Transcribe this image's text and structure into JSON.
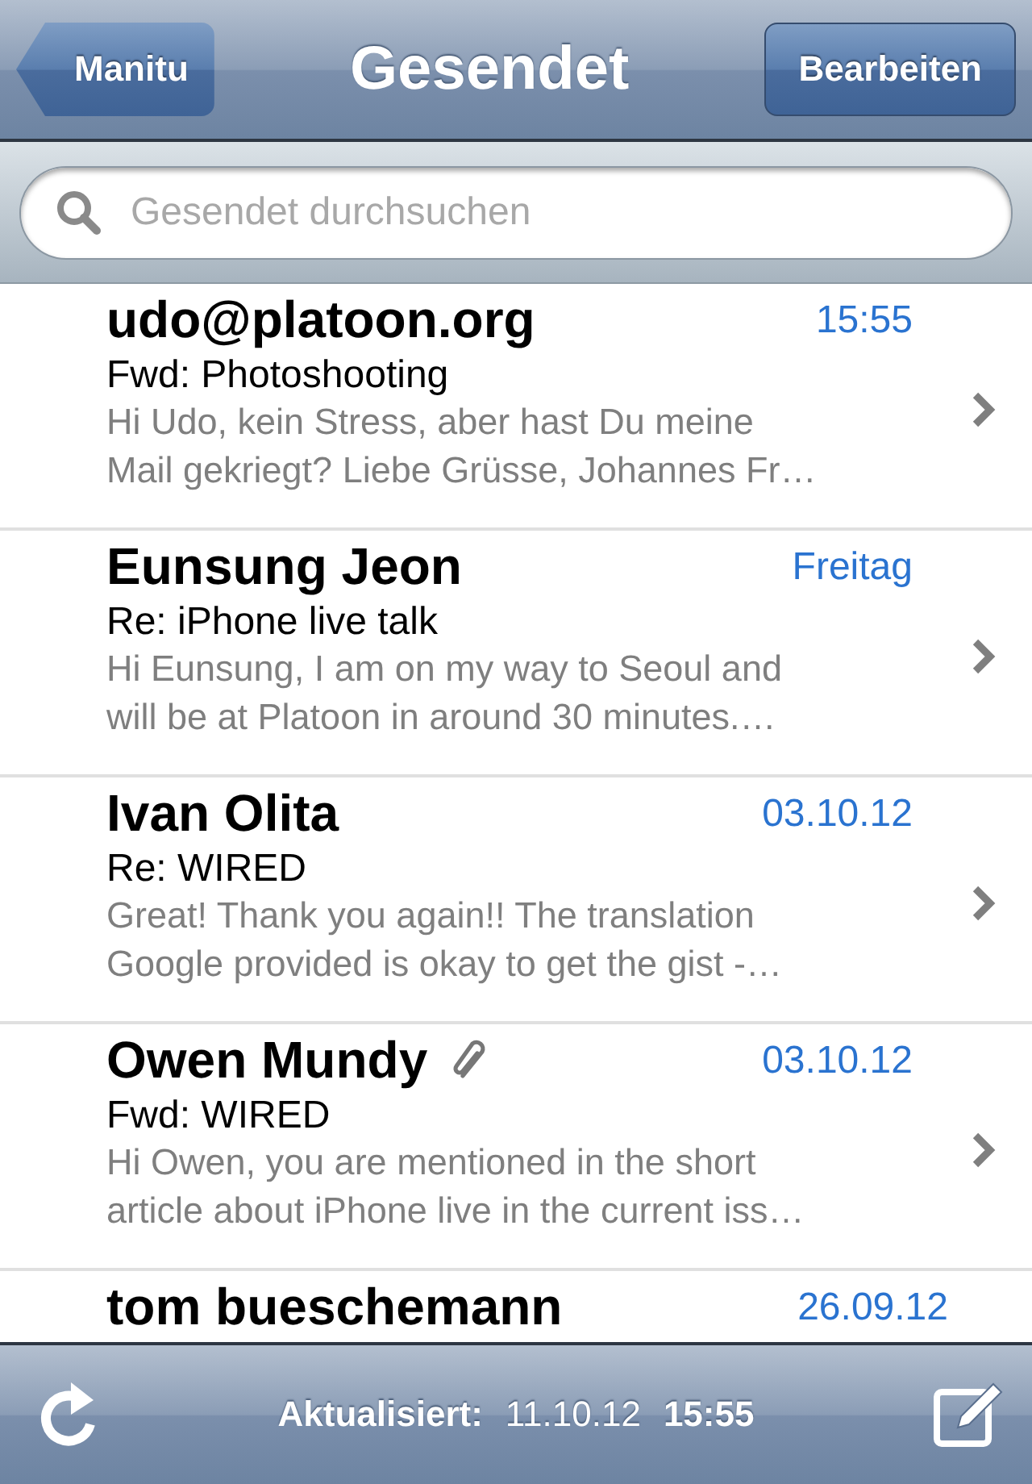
{
  "nav_bar": {
    "back_button": "Manitu",
    "title": "Gesendet",
    "edit_button": "Bearbeiten"
  },
  "search": {
    "placeholder": "Gesendet durchsuchen"
  },
  "messages": [
    {
      "sender": "udo@platoon.org",
      "date": "15:55",
      "subject": "Fwd: Photoshooting",
      "preview": [
        "Hi Udo, kein Stress, aber hast Du meine",
        "Mail gekriegt? Liebe Grüsse, Johannes Fr…"
      ],
      "attachment": false
    },
    {
      "sender": "Eunsung Jeon",
      "date": "Freitag",
      "subject": "Re: iPhone live talk",
      "preview": [
        "Hi Eunsung, I am on my way to Seoul and",
        "will be at Platoon in around 30 minutes.…"
      ],
      "attachment": false
    },
    {
      "sender": "Ivan Olita",
      "date": "03.10.12",
      "subject": "Re: WIRED",
      "preview": [
        "Great! Thank you again!! The translation",
        "Google provided is okay to get the gist -…"
      ],
      "attachment": false
    },
    {
      "sender": "Owen Mundy",
      "date": "03.10.12",
      "subject": "Fwd: WIRED",
      "preview": [
        "Hi Owen, you are mentioned in the short",
        "article about iPhone live in the current iss…"
      ],
      "attachment": true
    },
    {
      "sender": "tom bueschemann",
      "date": "26.09.12",
      "attachment": false
    }
  ],
  "toolbar": {
    "label": "Aktualisiert:",
    "date": "11.10.12",
    "time": "15:55"
  }
}
